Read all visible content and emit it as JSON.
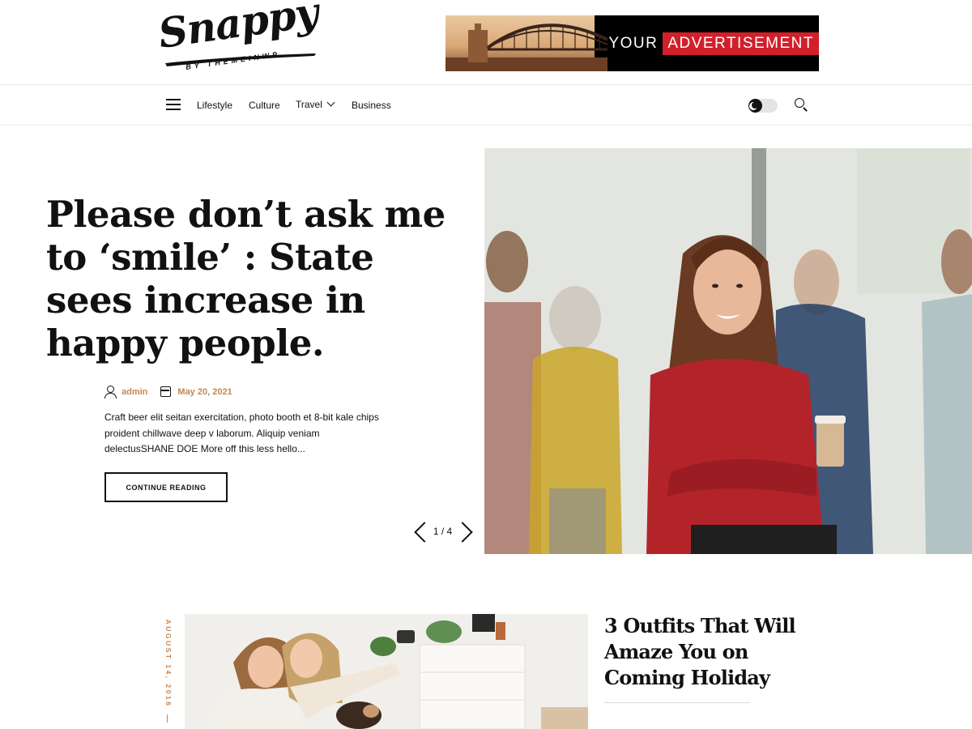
{
  "logo": {
    "name": "Snappy",
    "tagline": "BY THEMEINWP"
  },
  "ad": {
    "text_1": "YOUR",
    "text_2": "ADVERTISEMENT"
  },
  "nav": {
    "items": [
      {
        "label": "Lifestyle"
      },
      {
        "label": "Culture"
      },
      {
        "label": "Travel",
        "has_dropdown": true
      },
      {
        "label": "Business"
      }
    ]
  },
  "hero": {
    "title": "Please don’t ask me to ‘smile’ : State sees increase in happy people.",
    "author": "admin",
    "date": "May 20, 2021",
    "excerpt": "Craft beer elit seitan exercitation, photo booth et 8-bit kale chips proident chillwave deep v laborum. Aliquip veniam delectusSHANE DOE More off this less hello...",
    "button_label": "CONTINUE READING",
    "counter": "1 / 4"
  },
  "post": {
    "date": "AUGUST 14, 2016",
    "title": "3 Outfits That Will Amaze You on Coming Holiday"
  },
  "colors": {
    "accent": "#c28850",
    "ad_red": "#d1202b",
    "text": "#111111"
  }
}
